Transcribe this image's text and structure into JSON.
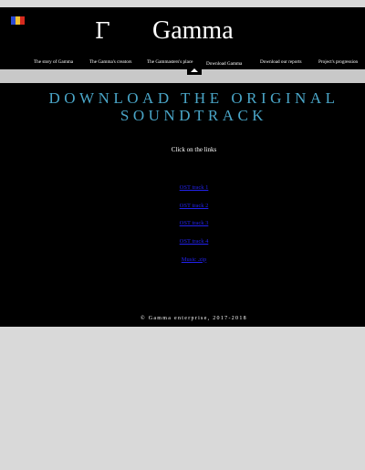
{
  "header": {
    "flag_colors": [
      "#2b4bd1",
      "#f2c230",
      "#d62a1e"
    ],
    "logo_glyph": "Γ",
    "logo_text": "Gamma"
  },
  "nav": {
    "items": [
      "The story of Gamma",
      "The Gamma's creators",
      "The Gammasters's place",
      "Download Gamma",
      "Download our reports",
      "Project's progression"
    ]
  },
  "main": {
    "title_line1": "DOWNLOAD THE ORIGINAL",
    "title_line2": "SOUNDTRACK",
    "instructions": "Click on the links",
    "links": [
      "OST track 1",
      "OST track 2",
      "OST track 3",
      "OST track 4",
      "Music .zip"
    ],
    "link_color": "#2222ee",
    "title_color": "#4aa6c8"
  },
  "footer": {
    "copyright": "© Gamma enterprise, 2017-2018"
  }
}
